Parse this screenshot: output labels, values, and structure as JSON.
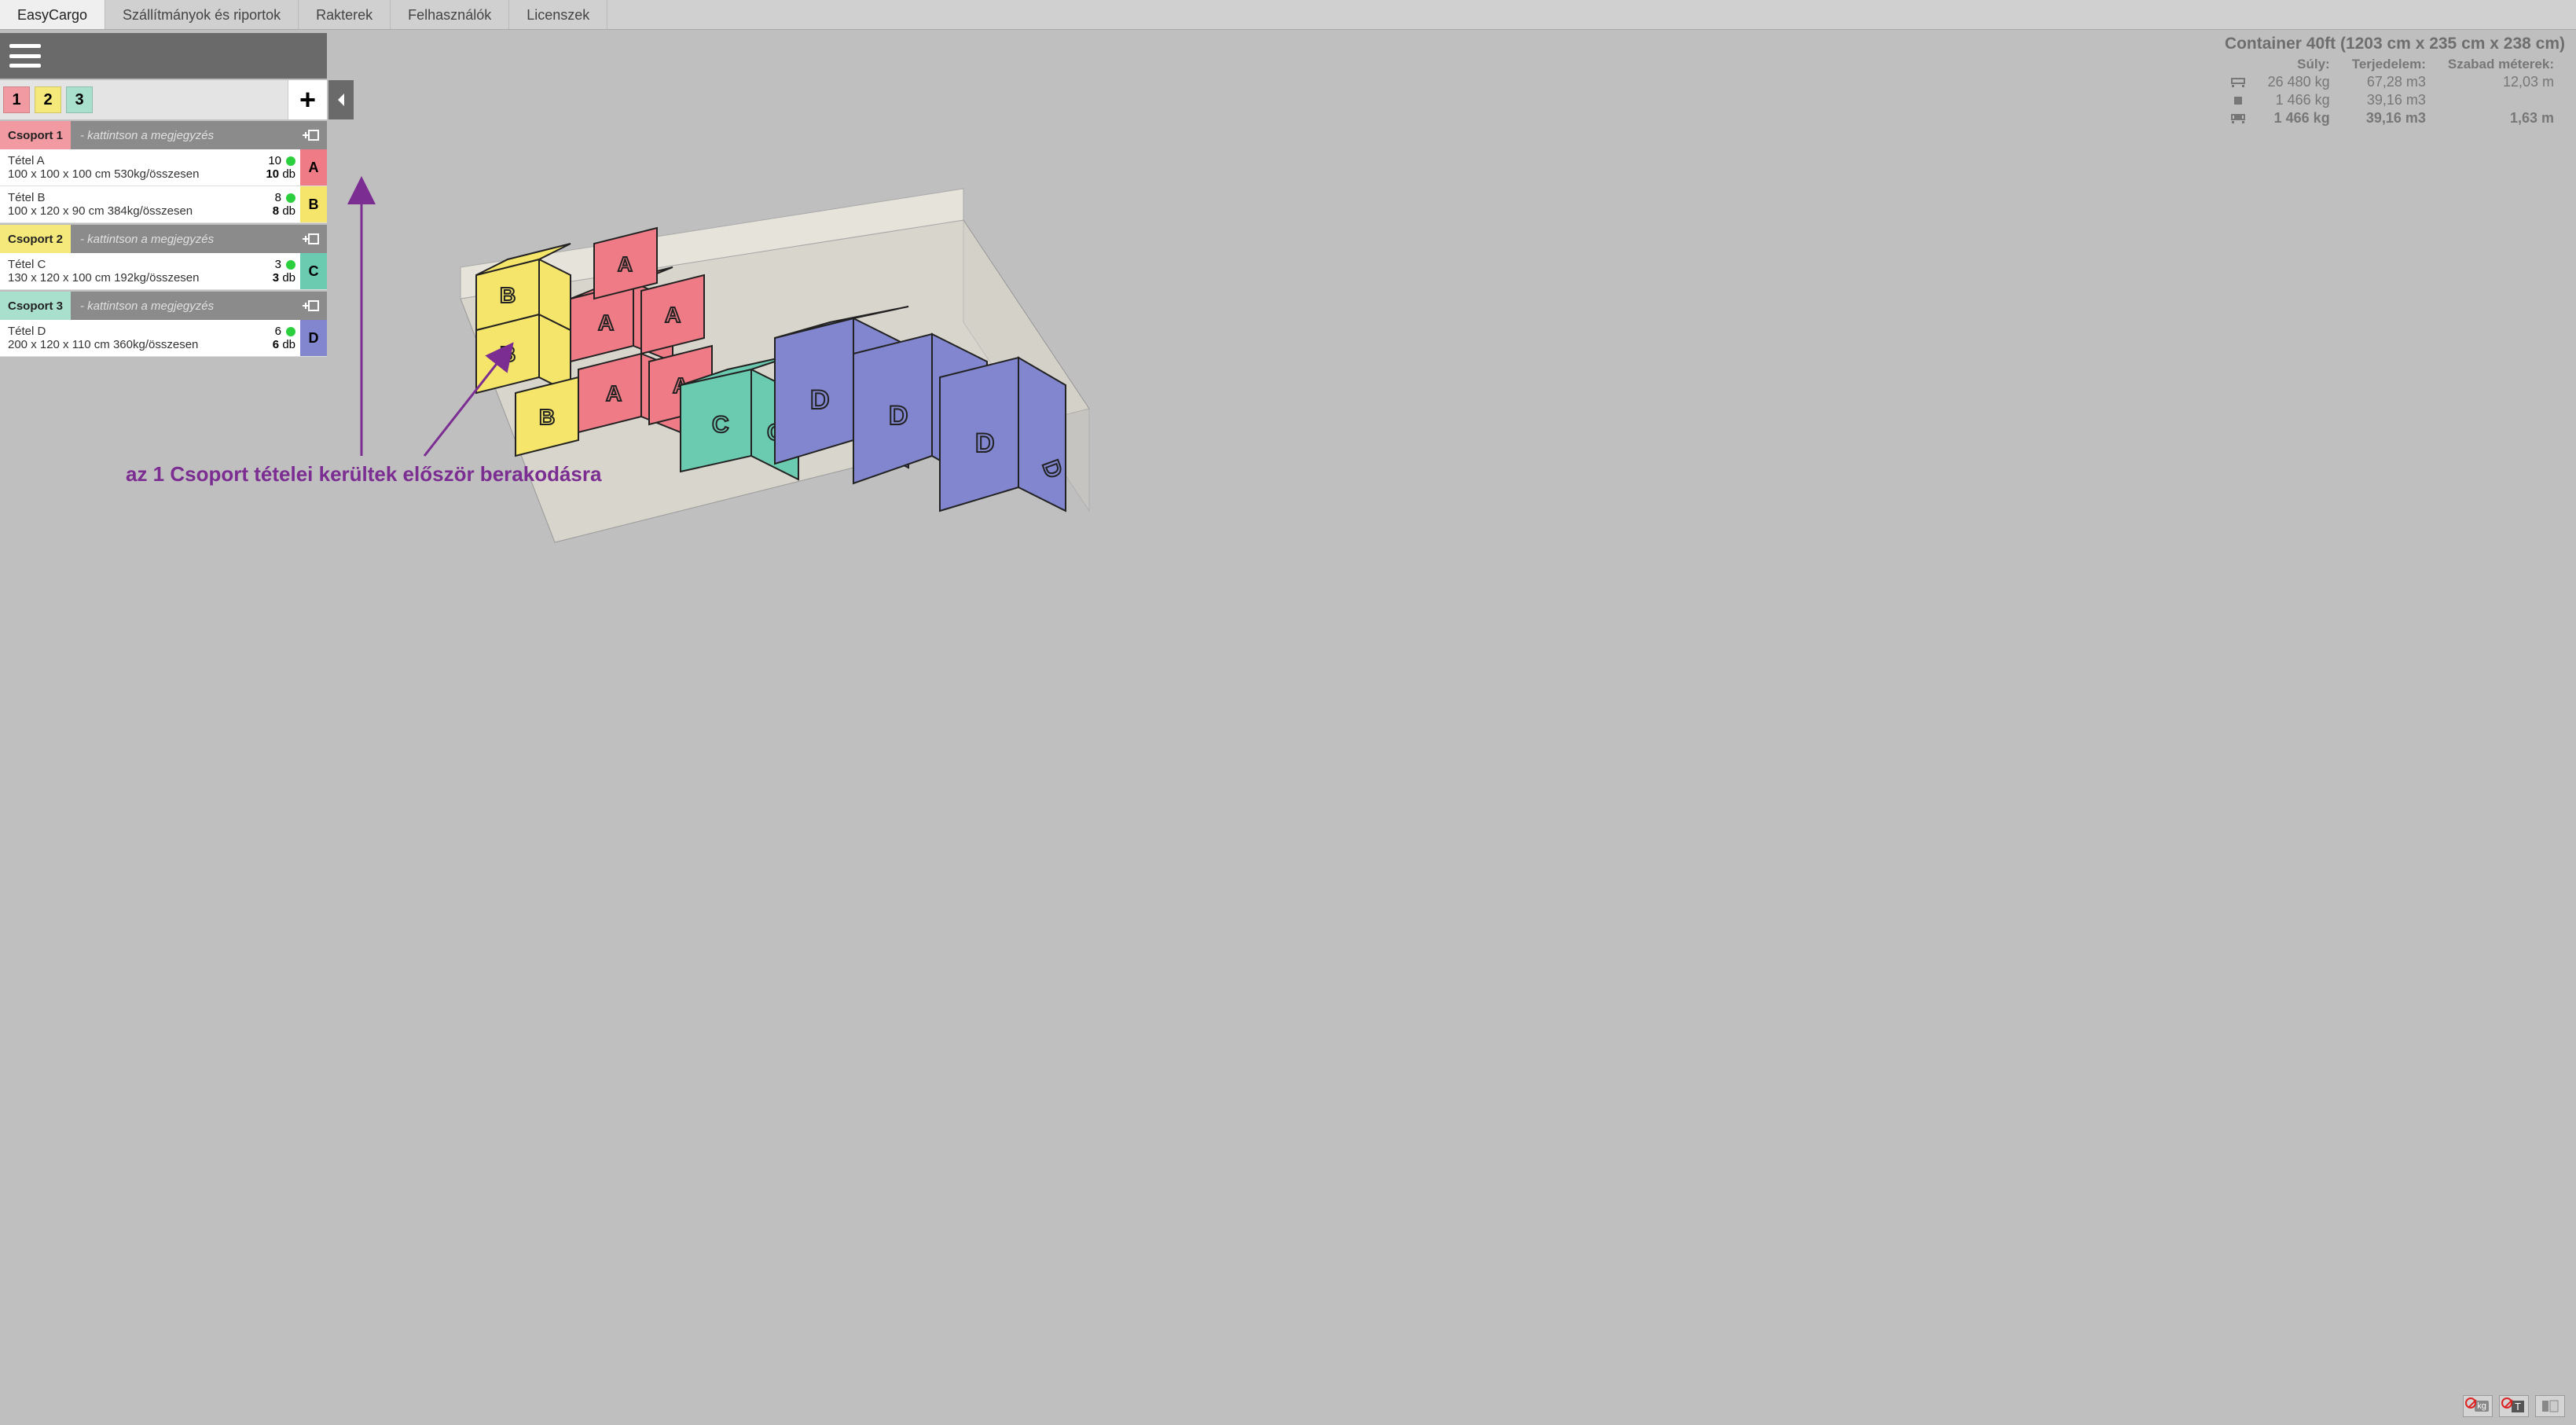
{
  "nav": {
    "items": [
      "EasyCargo",
      "Szállítmányok és riportok",
      "Rakterek",
      "Felhasználók",
      "Licenszek"
    ],
    "active_index": 0
  },
  "group_tabs": [
    "1",
    "2",
    "3"
  ],
  "plus_label": "+",
  "groups": [
    {
      "name": "Csoport 1",
      "note": "- kattintson a megjegyzés",
      "items": [
        {
          "name": "Tétel A",
          "dims": "100 x 100 x 100 cm 530kg/összesen",
          "qty_top": "10",
          "qty_bottom": "10",
          "unit": "db",
          "letter": "A",
          "color_class": "A"
        },
        {
          "name": "Tétel B",
          "dims": "100 x 120 x 90 cm 384kg/összesen",
          "qty_top": "8",
          "qty_bottom": "8",
          "unit": "db",
          "letter": "B",
          "color_class": "B"
        }
      ]
    },
    {
      "name": "Csoport 2",
      "note": "- kattintson a megjegyzés",
      "items": [
        {
          "name": "Tétel C",
          "dims": "130 x 120 x 100 cm 192kg/összesen",
          "qty_top": "3",
          "qty_bottom": "3",
          "unit": "db",
          "letter": "C",
          "color_class": "C"
        }
      ]
    },
    {
      "name": "Csoport 3",
      "note": "- kattintson a megjegyzés",
      "items": [
        {
          "name": "Tétel D",
          "dims": "200 x 120 x 110 cm 360kg/összesen",
          "qty_top": "6",
          "qty_bottom": "6",
          "unit": "db",
          "letter": "D",
          "color_class": "D"
        }
      ]
    }
  ],
  "info": {
    "title": "Container 40ft (1203 cm x 235 cm x 238 cm)",
    "headers": {
      "weight": "Súly:",
      "volume": "Terjedelem:",
      "free": "Szabad méterek:"
    },
    "rows": [
      {
        "icon": "container-empty",
        "weight": "26 480 kg",
        "volume": "67,28 m3",
        "free": "12,03 m"
      },
      {
        "icon": "cargo-box",
        "weight": "1 466 kg",
        "volume": "39,16 m3",
        "free": ""
      },
      {
        "icon": "container-loaded",
        "weight": "1 466 kg",
        "volume": "39,16 m3",
        "free": "1,63 m",
        "bold": true
      }
    ]
  },
  "annotation": "az 1 Csoport tételei kerültek először berakodásra",
  "colors": {
    "A": "#ee7b85",
    "B": "#f5e56a",
    "C": "#6bcbb0",
    "D": "#8186cf",
    "accent_purple": "#7b2d92"
  },
  "toolbar": {
    "weight_toggle": "kg",
    "text_toggle": "T",
    "layout_toggle": "layout"
  }
}
